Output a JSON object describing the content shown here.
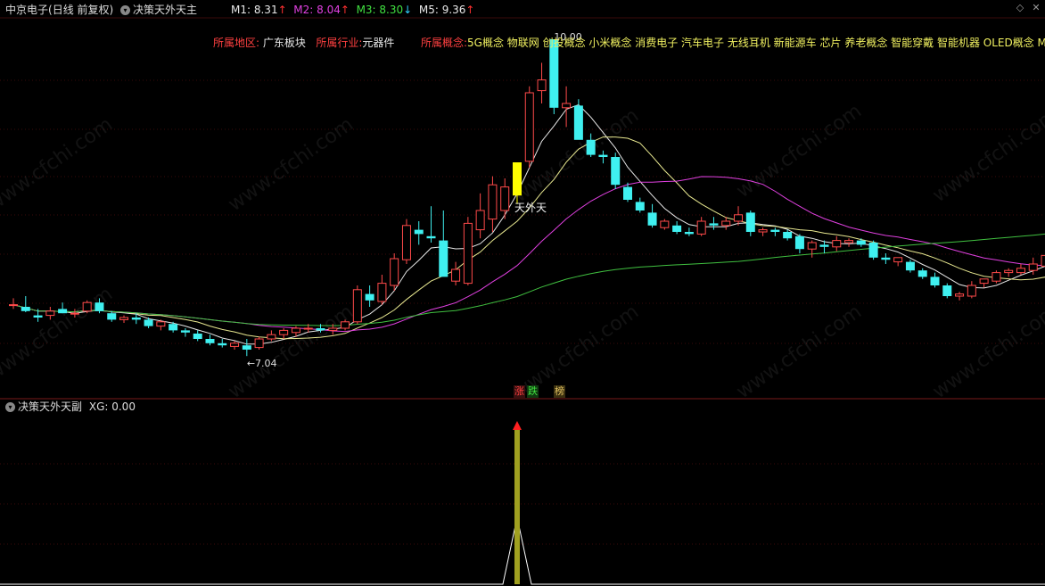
{
  "header": {
    "stock": "中京电子",
    "period": "(日线 前复权)",
    "indicator": "决策天外天主",
    "ma": [
      {
        "label": "M1:",
        "value": "8.31",
        "arrow": "↑",
        "color": "#e8e8e8",
        "arrow_color": "#ff3030"
      },
      {
        "label": "M2:",
        "value": "8.04",
        "arrow": "↑",
        "color": "#e040e0",
        "arrow_color": "#ff3030"
      },
      {
        "label": "M3:",
        "value": "8.30",
        "arrow": "↓",
        "color": "#40e040",
        "arrow_color": "#30d0ff"
      },
      {
        "label": "M5:",
        "value": "9.36",
        "arrow": "↑",
        "color": "#e8e8e8",
        "arrow_color": "#ff3030"
      }
    ]
  },
  "info": {
    "region_label": "所属地区:",
    "region_value": "广东板块",
    "industry_label": "所属行业:",
    "industry_value": "元器件",
    "concept_label": "所属概念:",
    "concept_value": "5G概念 物联网 创投概念 小米概念 消费电子 汽车电子 无线耳机 新能源车 芯片 养老概念 智能穿戴 智能机器 OLED概念 Mi"
  },
  "annotations": {
    "high_label": "10.00",
    "low_label": "←7.04",
    "signal_label": "天外天",
    "tag_up": "涨",
    "tag_down": "跌",
    "tag_rank": "榜"
  },
  "sub": {
    "indicator": "决策天外天副",
    "xg_label": "XG:",
    "xg_value": "0.00"
  },
  "watermark": "www.cfchi.com",
  "colors": {
    "up": "#ff4a4a",
    "down": "#3ff0f0",
    "signal": "#ffff00",
    "m1": "#e8e8e8",
    "m2": "#e8e890",
    "m3": "#e040e0",
    "m5": "#40c040",
    "sub_bar": "#a0a020"
  },
  "chart_data": {
    "type": "candlestick",
    "price_range": [
      6.8,
      10.2
    ],
    "candles": [
      {
        "o": 7.52,
        "h": 7.58,
        "l": 7.48,
        "c": 7.52
      },
      {
        "o": 7.5,
        "h": 7.6,
        "l": 7.45,
        "c": 7.46
      },
      {
        "o": 7.42,
        "h": 7.48,
        "l": 7.36,
        "c": 7.4
      },
      {
        "o": 7.42,
        "h": 7.5,
        "l": 7.38,
        "c": 7.46
      },
      {
        "o": 7.48,
        "h": 7.54,
        "l": 7.44,
        "c": 7.44
      },
      {
        "o": 7.44,
        "h": 7.48,
        "l": 7.4,
        "c": 7.44
      },
      {
        "o": 7.46,
        "h": 7.56,
        "l": 7.44,
        "c": 7.54
      },
      {
        "o": 7.54,
        "h": 7.58,
        "l": 7.44,
        "c": 7.46
      },
      {
        "o": 7.44,
        "h": 7.46,
        "l": 7.36,
        "c": 7.38
      },
      {
        "o": 7.38,
        "h": 7.42,
        "l": 7.35,
        "c": 7.4
      },
      {
        "o": 7.4,
        "h": 7.44,
        "l": 7.34,
        "c": 7.38
      },
      {
        "o": 7.38,
        "h": 7.4,
        "l": 7.3,
        "c": 7.32
      },
      {
        "o": 7.32,
        "h": 7.38,
        "l": 7.28,
        "c": 7.36
      },
      {
        "o": 7.34,
        "h": 7.36,
        "l": 7.26,
        "c": 7.28
      },
      {
        "o": 7.28,
        "h": 7.3,
        "l": 7.22,
        "c": 7.26
      },
      {
        "o": 7.25,
        "h": 7.28,
        "l": 7.18,
        "c": 7.2
      },
      {
        "o": 7.2,
        "h": 7.24,
        "l": 7.14,
        "c": 7.16
      },
      {
        "o": 7.16,
        "h": 7.2,
        "l": 7.12,
        "c": 7.14
      },
      {
        "o": 7.13,
        "h": 7.18,
        "l": 7.1,
        "c": 7.16
      },
      {
        "o": 7.14,
        "h": 7.2,
        "l": 7.04,
        "c": 7.1
      },
      {
        "o": 7.12,
        "h": 7.22,
        "l": 7.1,
        "c": 7.2
      },
      {
        "o": 7.2,
        "h": 7.28,
        "l": 7.18,
        "c": 7.24
      },
      {
        "o": 7.24,
        "h": 7.3,
        "l": 7.2,
        "c": 7.28
      },
      {
        "o": 7.26,
        "h": 7.32,
        "l": 7.22,
        "c": 7.3
      },
      {
        "o": 7.3,
        "h": 7.34,
        "l": 7.26,
        "c": 7.3
      },
      {
        "o": 7.3,
        "h": 7.34,
        "l": 7.26,
        "c": 7.28
      },
      {
        "o": 7.28,
        "h": 7.34,
        "l": 7.24,
        "c": 7.3
      },
      {
        "o": 7.3,
        "h": 7.38,
        "l": 7.28,
        "c": 7.36
      },
      {
        "o": 7.36,
        "h": 7.7,
        "l": 7.34,
        "c": 7.66
      },
      {
        "o": 7.62,
        "h": 7.7,
        "l": 7.5,
        "c": 7.56
      },
      {
        "o": 7.55,
        "h": 7.8,
        "l": 7.52,
        "c": 7.72
      },
      {
        "o": 7.7,
        "h": 8.0,
        "l": 7.65,
        "c": 7.95
      },
      {
        "o": 7.94,
        "h": 8.32,
        "l": 7.9,
        "c": 8.26
      },
      {
        "o": 8.22,
        "h": 8.3,
        "l": 8.08,
        "c": 8.18
      },
      {
        "o": 8.16,
        "h": 8.44,
        "l": 8.1,
        "c": 8.14
      },
      {
        "o": 8.12,
        "h": 8.4,
        "l": 8.0,
        "c": 7.78
      },
      {
        "o": 7.74,
        "h": 7.92,
        "l": 7.7,
        "c": 7.85
      },
      {
        "o": 7.72,
        "h": 8.34,
        "l": 7.7,
        "c": 8.28
      },
      {
        "o": 8.22,
        "h": 8.56,
        "l": 8.14,
        "c": 8.4
      },
      {
        "o": 8.32,
        "h": 8.72,
        "l": 8.2,
        "c": 8.64
      },
      {
        "o": 8.4,
        "h": 8.7,
        "l": 8.32,
        "c": 8.62
      },
      {
        "o": 8.54,
        "h": 8.78,
        "l": 8.46,
        "c": 8.85,
        "signal": true
      },
      {
        "o": 8.86,
        "h": 9.56,
        "l": 8.8,
        "c": 9.5
      },
      {
        "o": 9.52,
        "h": 9.78,
        "l": 9.4,
        "c": 9.62
      },
      {
        "o": 10.0,
        "h": 10.0,
        "l": 9.3,
        "c": 9.36
      },
      {
        "o": 9.36,
        "h": 9.56,
        "l": 9.18,
        "c": 9.4
      },
      {
        "o": 9.38,
        "h": 9.44,
        "l": 9.14,
        "c": 9.06
      },
      {
        "o": 9.06,
        "h": 9.12,
        "l": 8.9,
        "c": 8.92
      },
      {
        "o": 8.92,
        "h": 8.96,
        "l": 8.84,
        "c": 8.9
      },
      {
        "o": 8.9,
        "h": 8.94,
        "l": 8.6,
        "c": 8.64
      },
      {
        "o": 8.62,
        "h": 8.66,
        "l": 8.48,
        "c": 8.5
      },
      {
        "o": 8.48,
        "h": 8.52,
        "l": 8.38,
        "c": 8.4
      },
      {
        "o": 8.38,
        "h": 8.46,
        "l": 8.24,
        "c": 8.26
      },
      {
        "o": 8.24,
        "h": 8.32,
        "l": 8.22,
        "c": 8.3
      },
      {
        "o": 8.26,
        "h": 8.3,
        "l": 8.18,
        "c": 8.2
      },
      {
        "o": 8.2,
        "h": 8.24,
        "l": 8.16,
        "c": 8.18
      },
      {
        "o": 8.18,
        "h": 8.34,
        "l": 8.16,
        "c": 8.3
      },
      {
        "o": 8.28,
        "h": 8.34,
        "l": 8.22,
        "c": 8.26
      },
      {
        "o": 8.26,
        "h": 8.34,
        "l": 8.22,
        "c": 8.3
      },
      {
        "o": 8.3,
        "h": 8.44,
        "l": 8.26,
        "c": 8.36
      },
      {
        "o": 8.38,
        "h": 8.4,
        "l": 8.16,
        "c": 8.2
      },
      {
        "o": 8.2,
        "h": 8.24,
        "l": 8.16,
        "c": 8.22
      },
      {
        "o": 8.22,
        "h": 8.24,
        "l": 8.16,
        "c": 8.2
      },
      {
        "o": 8.2,
        "h": 8.22,
        "l": 8.12,
        "c": 8.14
      },
      {
        "o": 8.16,
        "h": 8.18,
        "l": 8.0,
        "c": 8.04
      },
      {
        "o": 8.04,
        "h": 8.12,
        "l": 7.96,
        "c": 8.1
      },
      {
        "o": 8.08,
        "h": 8.12,
        "l": 8.0,
        "c": 8.06
      },
      {
        "o": 8.06,
        "h": 8.16,
        "l": 8.02,
        "c": 8.12
      },
      {
        "o": 8.1,
        "h": 8.14,
        "l": 8.06,
        "c": 8.12
      },
      {
        "o": 8.12,
        "h": 8.14,
        "l": 8.06,
        "c": 8.08
      },
      {
        "o": 8.1,
        "h": 8.12,
        "l": 7.94,
        "c": 7.96
      },
      {
        "o": 7.96,
        "h": 8.0,
        "l": 7.9,
        "c": 7.94
      },
      {
        "o": 7.92,
        "h": 7.96,
        "l": 7.88,
        "c": 7.96
      },
      {
        "o": 7.92,
        "h": 7.94,
        "l": 7.82,
        "c": 7.84
      },
      {
        "o": 7.84,
        "h": 7.86,
        "l": 7.76,
        "c": 7.78
      },
      {
        "o": 7.78,
        "h": 7.82,
        "l": 7.68,
        "c": 7.7
      },
      {
        "o": 7.7,
        "h": 7.72,
        "l": 7.58,
        "c": 7.6
      },
      {
        "o": 7.6,
        "h": 7.64,
        "l": 7.56,
        "c": 7.62
      },
      {
        "o": 7.6,
        "h": 7.74,
        "l": 7.58,
        "c": 7.7
      },
      {
        "o": 7.72,
        "h": 7.76,
        "l": 7.68,
        "c": 7.76
      },
      {
        "o": 7.74,
        "h": 7.84,
        "l": 7.72,
        "c": 7.82
      },
      {
        "o": 7.82,
        "h": 7.86,
        "l": 7.78,
        "c": 7.84
      },
      {
        "o": 7.82,
        "h": 7.9,
        "l": 7.8,
        "c": 7.86
      },
      {
        "o": 7.84,
        "h": 7.96,
        "l": 7.8,
        "c": 7.9
      },
      {
        "o": 7.88,
        "h": 8.02,
        "l": 7.86,
        "c": 7.98
      }
    ],
    "sub_series": {
      "name": "XG",
      "signal_index": 41,
      "range": [
        0,
        1
      ]
    }
  }
}
